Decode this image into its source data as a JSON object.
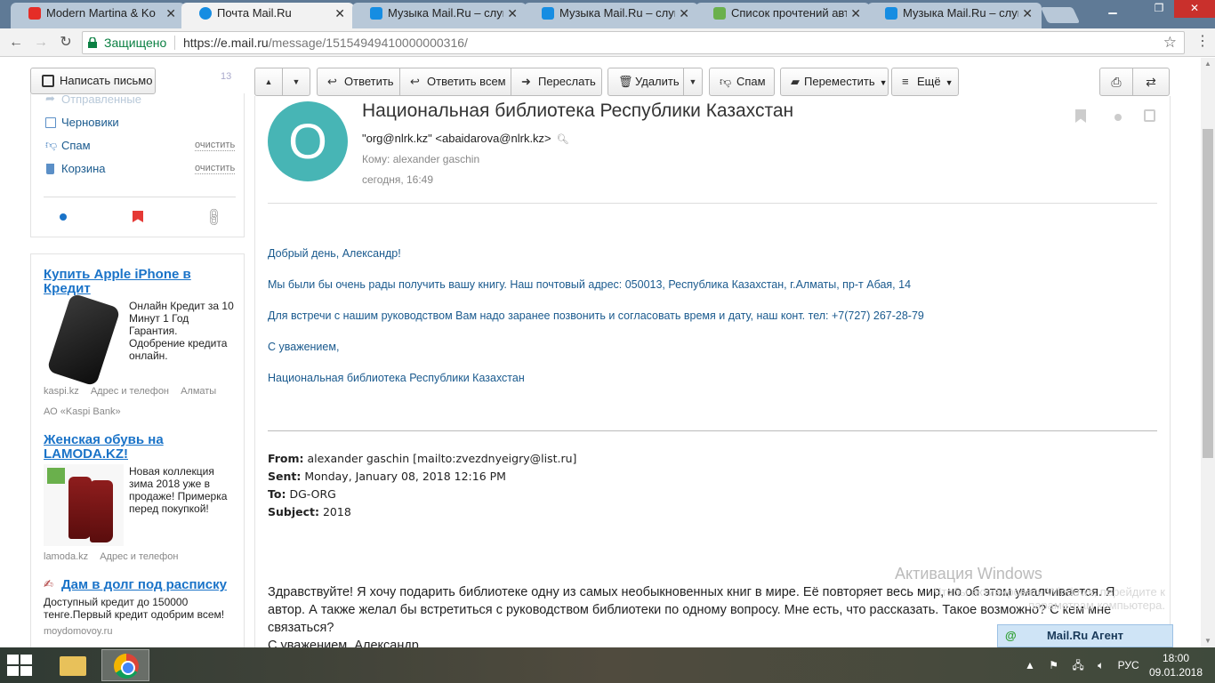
{
  "tabs": [
    {
      "label": "Modern Martina & Ko",
      "favicon_color": "#e52d27",
      "active": false
    },
    {
      "label": "Почта Mail.Ru",
      "favicon_color": "#168de2",
      "active": true
    },
    {
      "label": "Музыка Mail.Ru – слуша",
      "favicon_color": "#168de2",
      "active": false
    },
    {
      "label": "Музыка Mail.Ru – слуша",
      "favicon_color": "#168de2",
      "active": false
    },
    {
      "label": "Список прочтений авто",
      "favicon_color": "#6ab04c",
      "active": false
    },
    {
      "label": "Музыка Mail.Ru – слуша",
      "favicon_color": "#168de2",
      "active": false
    }
  ],
  "addressbar": {
    "secure_label": "Защищено",
    "url_host": "https://e.mail.ru",
    "url_path": "/message/15154949410000000316/"
  },
  "sidebar": {
    "compose_label": "Написать письмо",
    "sent_count": "13",
    "folders": [
      {
        "label": "Отправленные",
        "clear": ""
      },
      {
        "label": "Черновики",
        "clear": ""
      },
      {
        "label": "Спам",
        "clear": "очистить"
      },
      {
        "label": "Корзина",
        "clear": "очистить"
      }
    ]
  },
  "ads": [
    {
      "title": "Купить Apple iPhone в Кредит",
      "text": "Онлайн Кредит за 10 Минут 1 Год Гарантия. Одобрение кредита онлайн.",
      "domain": "kaspi.kz",
      "link1": "Адрес и телефон",
      "link2": "Алматы",
      "company": "АО «Kaspi Bank»"
    },
    {
      "title": "Женская обувь на LAMODA.KZ!",
      "text": "Новая коллекция зима 2018 уже в продаже! Примерка перед покупкой!",
      "domain": "lamoda.kz",
      "link1": "Адрес и телефон"
    },
    {
      "title": "Дам в долг под расписку",
      "text": "Доступный кредит до 150000 тенге.Первый кредит одобрим всем!",
      "domain": "moydomovoy.ru"
    }
  ],
  "toolbar": {
    "reply": "Ответить",
    "reply_all": "Ответить всем",
    "forward": "Переслать",
    "delete": "Удалить",
    "spam": "Спам",
    "move": "Переместить",
    "more": "Ещё"
  },
  "message": {
    "avatar_letter": "O",
    "subject": "Национальная библиотека Республики Казахстан",
    "from": "\"org@nlrk.kz\" <abaidarova@nlrk.kz>",
    "to_label": "Кому:",
    "to": "alexander gaschin",
    "date": "сегодня, 16:49",
    "body": [
      "Добрый день, Александр!",
      "Мы были бы очень рады получить вашу книгу. Наш почтовый адрес: 050013, Республика Казахстан, г.Алматы, пр-т Абая, 14",
      "Для встречи  с нашим руководством Вам надо заранее позвонить и согласовать время и дату, наш конт. тел: +7(727) 267-28-79",
      "С уважением,",
      "Национальная библиотека Республики Казахстан"
    ],
    "forwarded": {
      "from_label": "From:",
      "from": "alexander gaschin [mailto:zvezdnyeigry@list.ru]",
      "sent_label": "Sent:",
      "sent": "Monday, January 08, 2018 12:16 PM",
      "to_label": "To:",
      "to": "DG-ORG",
      "subject_label": "Subject:",
      "subject": "2018"
    },
    "original_text": "Здравствуйте! Я хочу подарить библиотеке одну из самых необыкновенных книг в мире. Её повторяет весь мир, но об этом умалчивается. Я автор. А также желал бы встретиться с руководством библиотеки по одному вопросу. Мне есть, что рассказать. Такое возможно? С кем мне связаться?",
    "signoff": "С уважением, Александр"
  },
  "overlay": {
    "activation": "Активация Windows",
    "activation_sub": "Чтобы активировать Windows, перейдите к параметрам компьютера.",
    "agent": "Mail.Ru Агент"
  },
  "taskbar": {
    "lang": "РУС",
    "time": "18:00",
    "date": "09.01.2018"
  }
}
